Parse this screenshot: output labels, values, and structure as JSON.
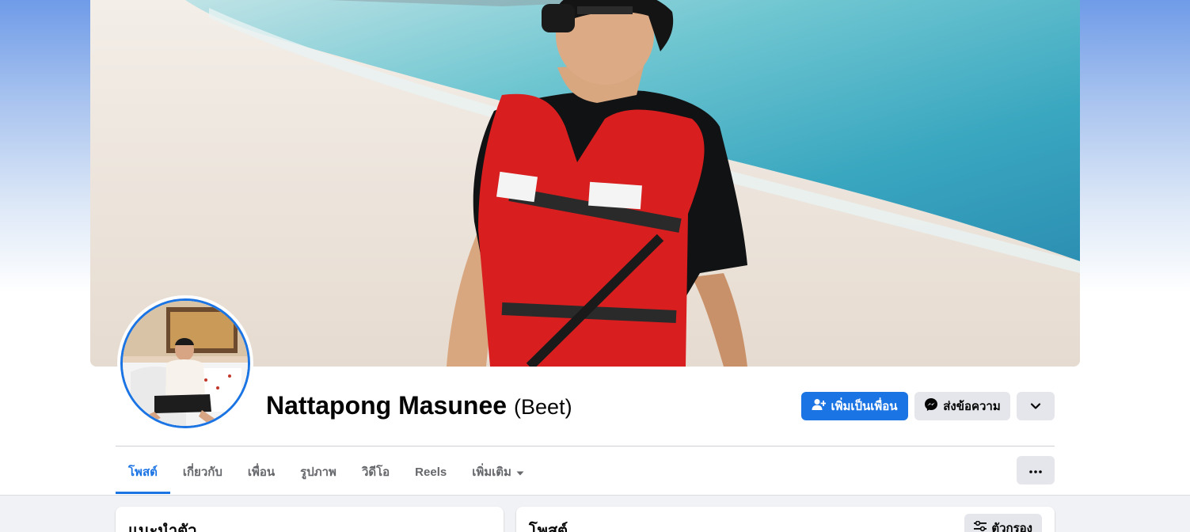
{
  "profile": {
    "name": "Nattapong Masunee",
    "alternate_name": "(Beet)"
  },
  "actions": {
    "add_friend_label": "เพิ่มเป็นเพื่อน",
    "message_label": "ส่งข้อความ"
  },
  "tabs": [
    {
      "label": "โพสต์",
      "active": true
    },
    {
      "label": "เกี่ยวกับ",
      "active": false
    },
    {
      "label": "เพื่อน",
      "active": false
    },
    {
      "label": "รูปภาพ",
      "active": false
    },
    {
      "label": "วิดีโอ",
      "active": false
    },
    {
      "label": "Reels",
      "active": false
    },
    {
      "label": "เพิ่มเติม",
      "active": false
    }
  ],
  "intro_card": {
    "title": "แนะนำตัว"
  },
  "posts_card": {
    "title": "โพสต์",
    "filter_label": "ตัวกรอง"
  },
  "colors": {
    "accent": "#1b74e4",
    "secondary_button": "#e4e6eb",
    "feed_background": "#f0f2f5"
  },
  "icons": {
    "add_friend": "add-person-icon",
    "message": "messenger-icon",
    "more": "chevron-down-icon",
    "tab_more": "caret-down-icon",
    "options": "ellipsis-icon",
    "filter": "sliders-icon"
  }
}
